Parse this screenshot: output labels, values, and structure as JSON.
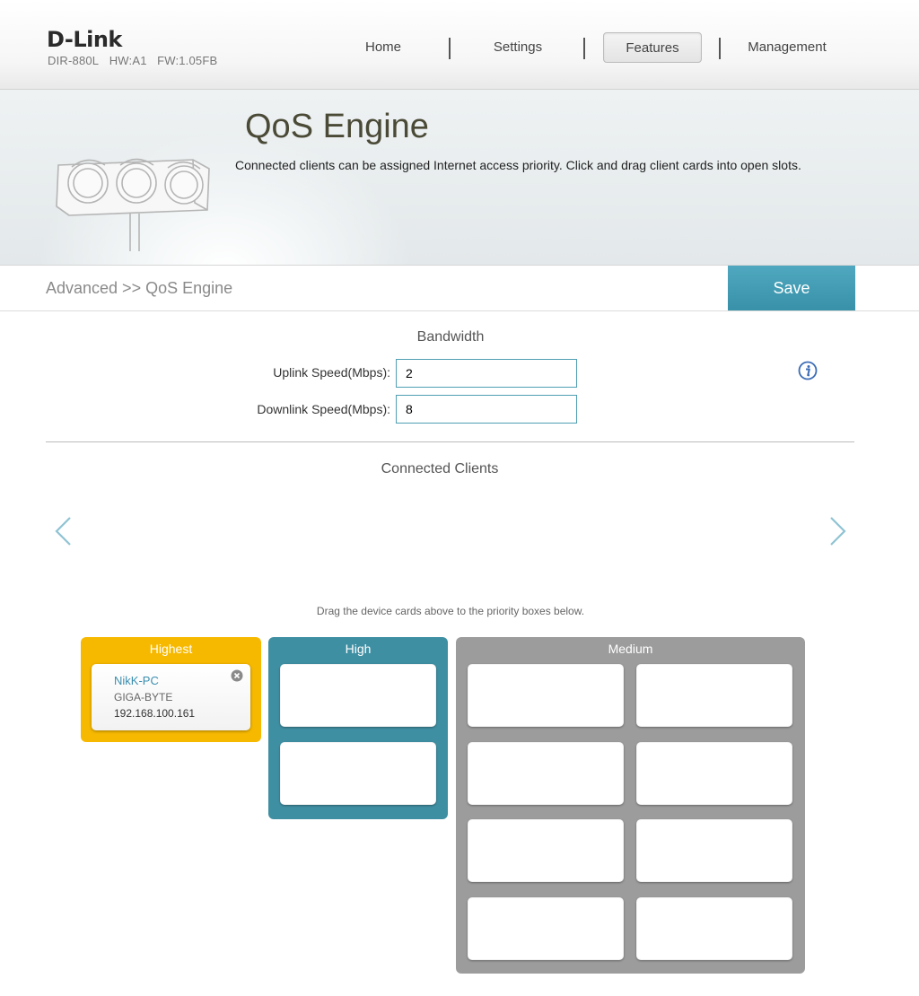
{
  "brand": {
    "logo": "D-Link",
    "model": "DIR-880L",
    "hw": "HW:A1",
    "fw": "FW:1.05FB"
  },
  "nav": {
    "items": [
      {
        "label": "Home",
        "active": false
      },
      {
        "label": "Settings",
        "active": false
      },
      {
        "label": "Features",
        "active": true
      },
      {
        "label": "Management",
        "active": false
      }
    ]
  },
  "banner": {
    "title": "QoS Engine",
    "description": "Connected clients can be assigned Internet access priority. Click and drag client cards into open slots."
  },
  "breadcrumb": "Advanced >> QoS Engine",
  "save_label": "Save",
  "bandwidth": {
    "title": "Bandwidth",
    "uplink_label": "Uplink Speed(Mbps):",
    "uplink_value": "2",
    "downlink_label": "Downlink Speed(Mbps):",
    "downlink_value": "8"
  },
  "connected_clients": {
    "title": "Connected Clients"
  },
  "drag_hint": "Drag the device cards above to the priority boxes below.",
  "priority": {
    "highest": {
      "label": "Highest",
      "color": "#f7b900",
      "client": {
        "name": "NikK-PC",
        "vendor": "GIGA-BYTE",
        "ip": "192.168.100.161"
      }
    },
    "high": {
      "label": "High",
      "color": "#3f8fa3"
    },
    "medium": {
      "label": "Medium",
      "color": "#9c9c9c"
    }
  },
  "colors": {
    "accent": "#3f99b0",
    "link": "#3c8fb0"
  }
}
